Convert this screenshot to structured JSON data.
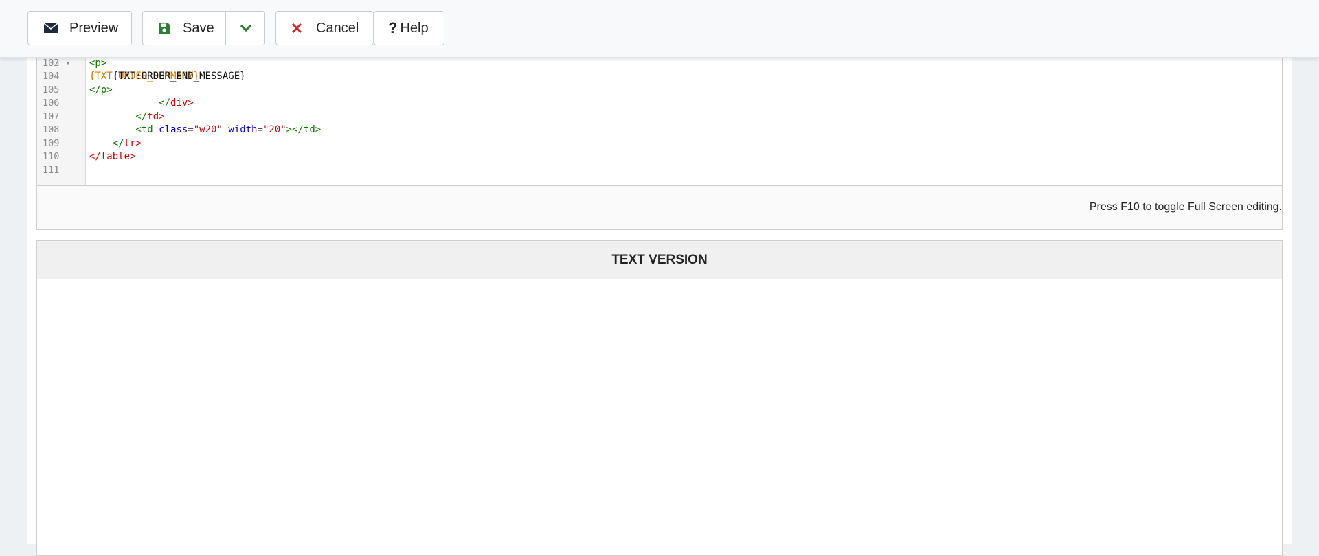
{
  "toolbar": {
    "preview_label": "Preview",
    "save_label": "Save",
    "cancel_label": "Cancel",
    "help_label": "Help",
    "help_icon_glyph": "?",
    "icons": {
      "preview": "envelope-icon",
      "save": "floppy-disk-icon",
      "save_dropdown": "chevron-down-icon",
      "cancel": "close-icon",
      "help": "question-icon"
    },
    "colors": {
      "save_icon": "#2e7d32",
      "cancel_icon": "#c62828",
      "dropdown_icon": "#2e7d32"
    }
  },
  "editor": {
    "lines": [
      {
        "num": "103",
        "fold": true,
        "parts": [
          {
            "t": "<p>",
            "c": "tag-b"
          }
        ]
      },
      {
        "num": "104",
        "parts": [
          {
            "t": "    {TXT:ORDER_END_MESSAGE}",
            "c": ""
          }
        ]
      },
      {
        "num": "105",
        "parts": [
          {
            "t": "</p>",
            "c": "tag-b"
          }
        ]
      },
      {
        "num": "106",
        "parts": [
          {
            "t": "            </",
            "c": "tag-b"
          },
          {
            "t": "div",
            "c": "tag-n"
          },
          {
            "t": ">",
            "c": "tag-n"
          }
        ]
      },
      {
        "num": "107",
        "parts": [
          {
            "t": "        </",
            "c": "tag-b"
          },
          {
            "t": "td",
            "c": "tag-n"
          },
          {
            "t": ">",
            "c": "tag-n"
          }
        ]
      },
      {
        "num": "108",
        "parts": [
          {
            "t": "        <td ",
            "c": "tag-b"
          },
          {
            "t": "class",
            "c": "attr"
          },
          {
            "t": "=",
            "c": ""
          },
          {
            "t": "\"w20\"",
            "c": "str"
          },
          {
            "t": " ",
            "c": ""
          },
          {
            "t": "width",
            "c": "attr"
          },
          {
            "t": "=",
            "c": ""
          },
          {
            "t": "\"20\"",
            "c": "str"
          },
          {
            "t": "></td>",
            "c": "tag-b"
          }
        ]
      },
      {
        "num": "109",
        "parts": [
          {
            "t": "    </",
            "c": "tag-b"
          },
          {
            "t": "tr",
            "c": "tag-n"
          },
          {
            "t": ">",
            "c": "tag-n"
          }
        ]
      },
      {
        "num": "110",
        "parts": [
          {
            "t": "</",
            "c": "tag-n"
          },
          {
            "t": "table",
            "c": "tag-n"
          },
          {
            "t": ">",
            "c": "tag-n"
          }
        ]
      },
      {
        "num": "111",
        "parts": []
      }
    ],
    "footer_hint": "Press F10 to toggle Full Screen editing."
  },
  "text_version": {
    "header": "TEXT VERSION",
    "value": ""
  }
}
